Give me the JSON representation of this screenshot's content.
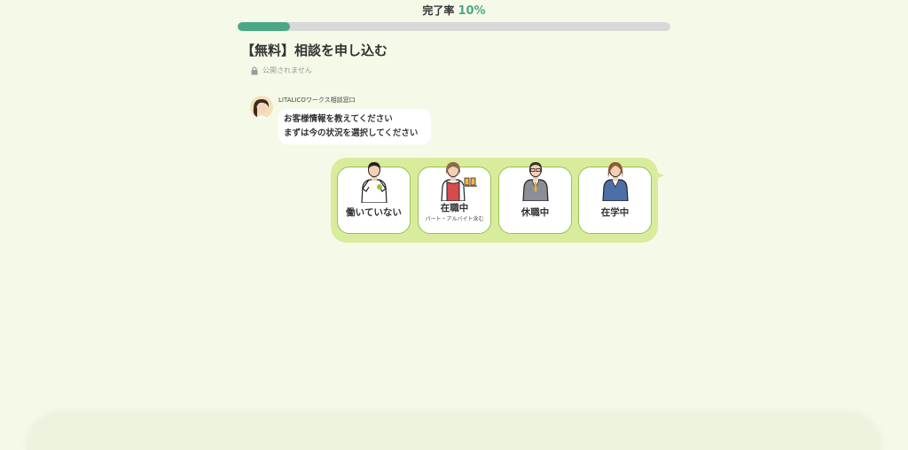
{
  "progress": {
    "label": "完了率",
    "value_text": "10%",
    "fraction": 0.12,
    "fill_color": "#4ba887",
    "track_color": "#d9d9d9"
  },
  "page": {
    "title": "【無料】相談を申し込む",
    "privacy_note": "公開されません",
    "background": "#f5fae8"
  },
  "chat": {
    "sender": "LITALICOワークス相談窓口",
    "message_line1": "お客様情報を教えてください",
    "message_line2": "まずは今の状況を選択してください"
  },
  "choices": [
    {
      "label": "働いていない",
      "sub": "",
      "icon": "person-tshirt-icon"
    },
    {
      "label": "在職中",
      "sub": "パート・アルバイト含む",
      "icon": "person-waiter-icon"
    },
    {
      "label": "休職中",
      "sub": "",
      "icon": "person-suit-icon"
    },
    {
      "label": "在学中",
      "sub": "",
      "icon": "person-student-icon"
    }
  ],
  "colors": {
    "accent": "#4ba887",
    "choice_panel": "#d9ec9b",
    "choice_border": "#97c258"
  }
}
